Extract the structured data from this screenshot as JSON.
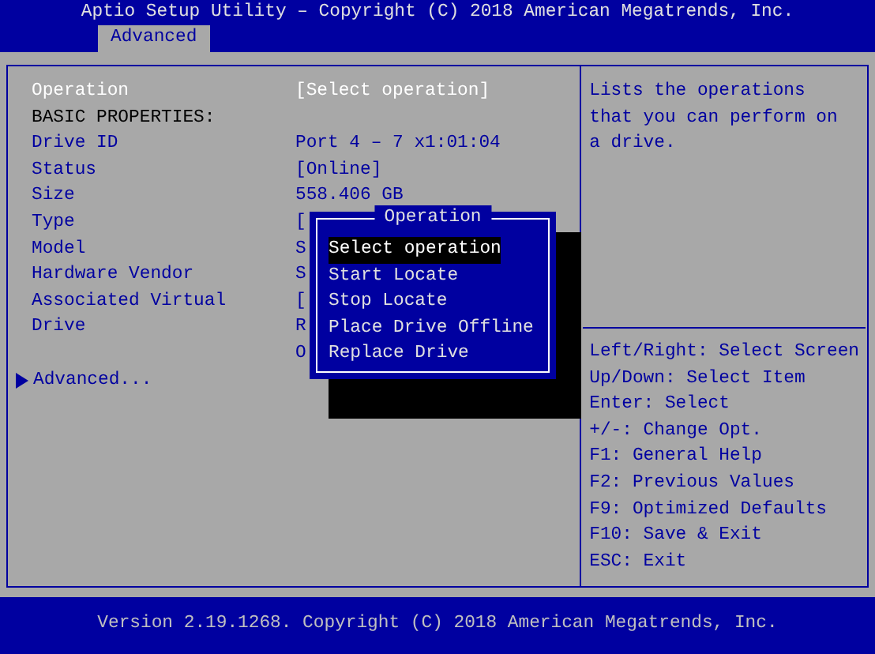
{
  "window": {
    "title": "Aptio Setup Utility – Copyright (C) 2018 American Megatrends, Inc."
  },
  "tabs": [
    {
      "label": "Advanced",
      "selected": true
    }
  ],
  "items": [
    {
      "kind": "setting",
      "label": "Operation",
      "value": "[Select operation]",
      "selected": true
    },
    {
      "kind": "header",
      "label": "BASIC PROPERTIES:",
      "selected": false
    },
    {
      "kind": "setting",
      "label": "Drive ID",
      "value": "Port 4 – 7 x1:01:04",
      "selected": false
    },
    {
      "kind": "setting",
      "label": "Status",
      "value": "[Online]",
      "selected": false
    },
    {
      "kind": "setting",
      "label": "Size",
      "value": "558.406 GB",
      "selected": false
    },
    {
      "kind": "setting",
      "label": "Type",
      "value": "[",
      "selected": false
    },
    {
      "kind": "setting",
      "label": "Model",
      "value": "S",
      "selected": false
    },
    {
      "kind": "setting",
      "label": "Hardware Vendor",
      "value": "S",
      "selected": false
    },
    {
      "kind": "setting",
      "label": "Associated Virtual",
      "value": "[",
      "selected": false
    },
    {
      "kind": "setting",
      "label": "Drive",
      "value": "R",
      "selected": false
    },
    {
      "kind": "setting",
      "value": "O",
      "selected": false
    },
    {
      "kind": "submenu",
      "label": "Advanced...",
      "selected": false
    }
  ],
  "help": "Lists the operations that you can perform on a drive.",
  "keys": [
    "Left/Right: Select Screen",
    "Up/Down: Select Item",
    "Enter: Select",
    "+/-: Change Opt.",
    "F1: General Help",
    "F2: Previous Values",
    "F9: Optimized Defaults",
    "F10: Save & Exit",
    "ESC: Exit"
  ],
  "popup": {
    "title": "Operation",
    "options": [
      {
        "label": "Select operation",
        "selected": true
      },
      {
        "label": "Start Locate",
        "selected": false
      },
      {
        "label": "Stop Locate",
        "selected": false
      },
      {
        "label": "Place Drive Offline",
        "selected": false
      },
      {
        "label": "Replace Drive",
        "selected": false
      }
    ]
  },
  "status_bar": "Version 2.19.1268. Copyright (C) 2018 American Megatrends, Inc."
}
